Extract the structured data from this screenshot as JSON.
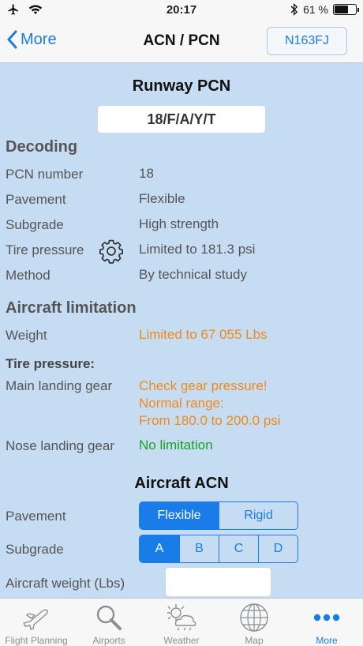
{
  "status_bar": {
    "time": "20:17",
    "battery_percent": "61 %"
  },
  "nav": {
    "back_label": "More",
    "title": "ACN / PCN",
    "registration": "N163FJ"
  },
  "runway": {
    "title": "Runway PCN",
    "pcn_code": "18/F/A/Y/T"
  },
  "decoding": {
    "title": "Decoding",
    "rows": [
      {
        "label": "PCN number",
        "value": "18"
      },
      {
        "label": "Pavement",
        "value": "Flexible"
      },
      {
        "label": "Subgrade",
        "value": "High strength"
      },
      {
        "label": "Tire pressure",
        "value": "Limited to 181.3 psi"
      },
      {
        "label": "Method",
        "value": "By technical study"
      }
    ]
  },
  "limitation": {
    "title": "Aircraft limitation",
    "weight_label": "Weight",
    "weight_value": "Limited to 67 055 Lbs",
    "tire_title": "Tire pressure:",
    "main_gear_label": "Main landing gear",
    "main_gear_line1": "Check gear pressure!",
    "main_gear_line2": "Normal range:",
    "main_gear_line3": "From 180.0 to 200.0 psi",
    "nose_gear_label": "Nose landing gear",
    "nose_gear_value": "No limitation"
  },
  "acn": {
    "title": "Aircraft ACN",
    "pavement_label": "Pavement",
    "pavement_options": [
      "Flexible",
      "Rigid"
    ],
    "pavement_selected": "Flexible",
    "subgrade_label": "Subgrade",
    "subgrade_options": [
      "A",
      "B",
      "C",
      "D"
    ],
    "subgrade_selected": "A",
    "weight_label": "Aircraft weight (Lbs)",
    "weight_value": ""
  },
  "tabs": [
    {
      "label": "Flight Planning",
      "icon": "airplane-icon"
    },
    {
      "label": "Airports",
      "icon": "magnifier-icon"
    },
    {
      "label": "Weather",
      "icon": "weather-icon"
    },
    {
      "label": "Map",
      "icon": "globe-icon"
    },
    {
      "label": "More",
      "icon": "more-dots-icon",
      "active": true
    }
  ],
  "colors": {
    "accent": "#1a7ce8",
    "warning": "#f08a1c",
    "ok": "#16a324",
    "background": "#c6dcf2"
  }
}
